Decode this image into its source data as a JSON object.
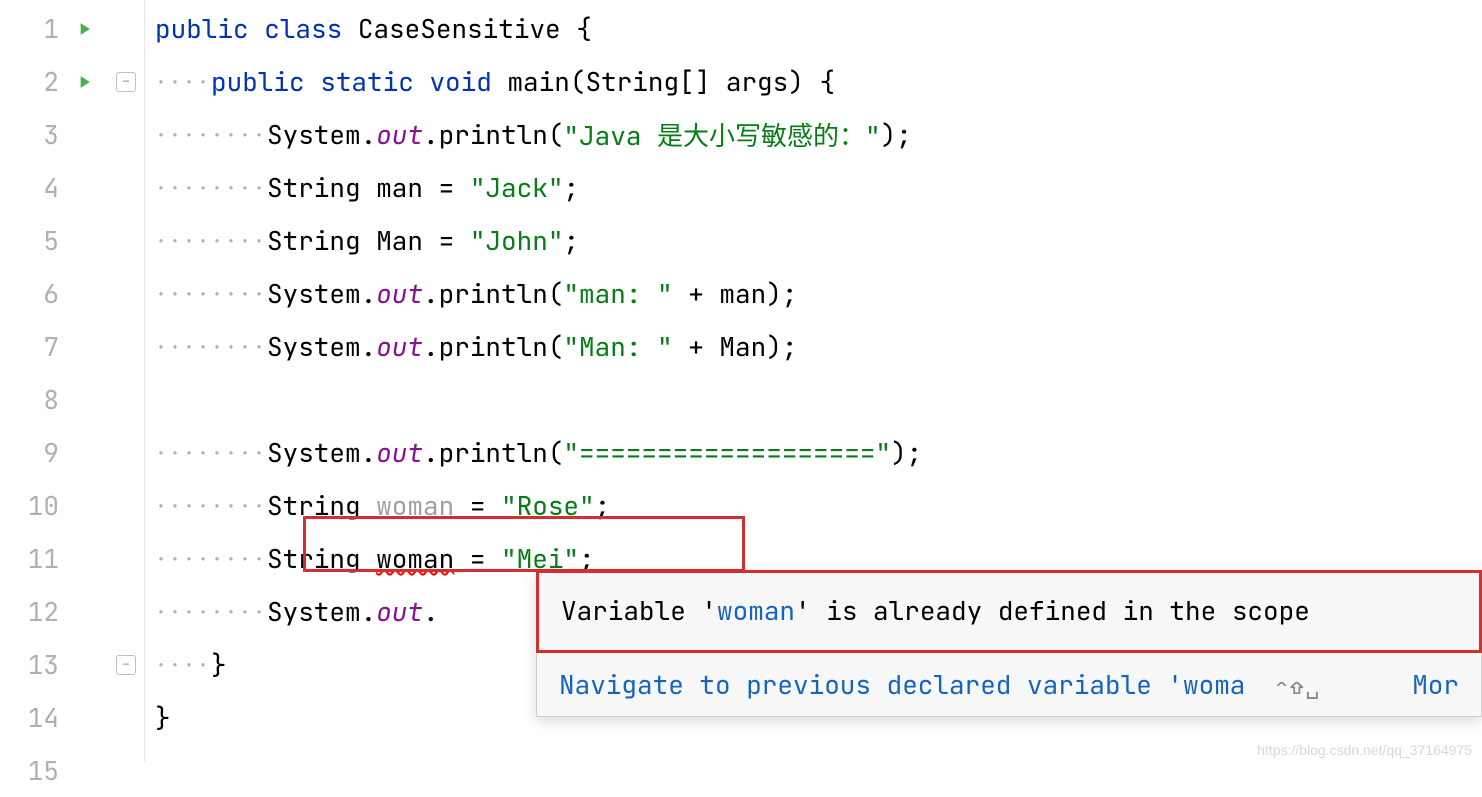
{
  "gutter": {
    "lines": [
      "1",
      "2",
      "3",
      "4",
      "5",
      "6",
      "7",
      "8",
      "9",
      "10",
      "11",
      "12",
      "13",
      "14",
      "15"
    ]
  },
  "code": {
    "line1": {
      "kw1": "public",
      "kw2": "class",
      "name": "CaseSensitive",
      "brace": " {"
    },
    "line2": {
      "kw1": "public",
      "kw2": "static",
      "kw3": "void",
      "method": "main",
      "params": "(String[] args) {"
    },
    "line3": {
      "sys": "System.",
      "out": "out",
      "call": ".println(",
      "str": "\"Java 是大小写敏感的：\"",
      "end": ");"
    },
    "line4": {
      "type": "String ",
      "var": "man",
      "assign": " = ",
      "str": "\"Jack\"",
      "end": ";"
    },
    "line5": {
      "type": "String ",
      "var": "Man",
      "assign": " = ",
      "str": "\"John\"",
      "end": ";"
    },
    "line6": {
      "sys": "System.",
      "out": "out",
      "call": ".println(",
      "str": "\"man: \"",
      "plus": " + man);"
    },
    "line7": {
      "sys": "System.",
      "out": "out",
      "call": ".println(",
      "str": "\"Man: \"",
      "plus": " + Man);"
    },
    "line9": {
      "sys": "System.",
      "out": "out",
      "call": ".println(",
      "str": "\"===================\"",
      "end": ");"
    },
    "line10": {
      "type": "String ",
      "var": "woman",
      "assign": " = ",
      "str": "\"Rose\"",
      "end": ";"
    },
    "line11": {
      "type": "String ",
      "var": "woman",
      "assign": " = ",
      "str": "\"Mei\"",
      "end": ";"
    },
    "line12": {
      "sys": "System.",
      "out": "out",
      "dot": "."
    },
    "line13": {
      "brace": "}"
    },
    "line14": {
      "brace": "}"
    }
  },
  "tooltip": {
    "message_pre": "Variable '",
    "message_var": "woman",
    "message_post": "' is already defined in the scope",
    "navigate": "Navigate to previous declared variable 'woma",
    "shortcut": "⌃⇧␣",
    "more": "Mor"
  },
  "watermark": "https://blog.csdn.net/qq_37164975"
}
